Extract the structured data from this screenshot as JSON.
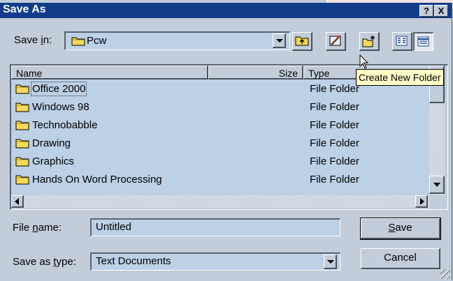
{
  "window": {
    "title": "Save As",
    "help_label": "?",
    "close_label": "X"
  },
  "save_in": {
    "label_pre": "Save ",
    "label_u": "i",
    "label_post": "n:",
    "value": "Pcw"
  },
  "toolbar": {
    "buttons": [
      {
        "icon": "up-folder-icon"
      },
      {
        "icon": "desktop-icon"
      },
      {
        "icon": "create-new-folder-icon"
      },
      {
        "icon": "list-view-icon"
      },
      {
        "icon": "details-view-icon"
      }
    ],
    "tooltip": "Create New Folder"
  },
  "file_list": {
    "columns": {
      "name": "Name",
      "size": "Size",
      "type": "Type"
    },
    "rows": [
      {
        "name": "Office 2000",
        "type": "File Folder"
      },
      {
        "name": "Windows 98",
        "type": "File Folder"
      },
      {
        "name": "Technobabble",
        "type": "File Folder"
      },
      {
        "name": "Drawing",
        "type": "File Folder"
      },
      {
        "name": "Graphics",
        "type": "File Folder"
      },
      {
        "name": "Hands On Word Processing",
        "type": "File Folder"
      }
    ]
  },
  "file_name": {
    "label_pre": "File ",
    "label_u": "n",
    "label_post": "ame:",
    "value": "Untitled"
  },
  "save_as_type": {
    "label_pre": "Save as ",
    "label_u": "t",
    "label_post": "ype:",
    "value": "Text Documents"
  },
  "buttons": {
    "save_u": "S",
    "save_rest": "ave",
    "cancel": "Cancel"
  },
  "colors": {
    "titlebar": "#113c8a",
    "field": "#bcd0e6",
    "face": "#c3cdd9",
    "tooltip": "#fffcc8"
  }
}
